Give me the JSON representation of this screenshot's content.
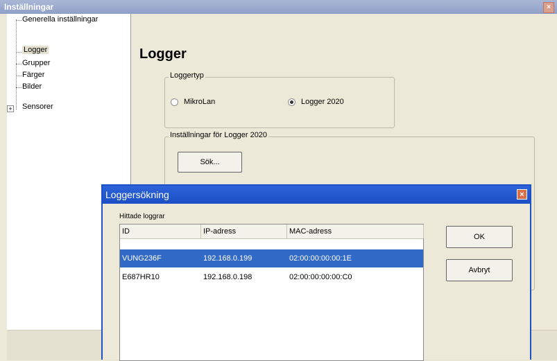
{
  "main_window": {
    "title": "Inställningar",
    "close_glyph": "×",
    "tree": {
      "items": [
        {
          "label": "Generella inställningar"
        },
        {
          "label": "Logger"
        },
        {
          "label": "Grupper"
        },
        {
          "label": "Färger"
        },
        {
          "label": "Bilder"
        },
        {
          "label": "Sensorer"
        }
      ],
      "expander_glyph": "+",
      "selected": "Logger"
    },
    "page_title": "Logger",
    "logger_type_group": {
      "legend": "Loggertyp",
      "options": [
        {
          "label": "MikroLan",
          "checked": false
        },
        {
          "label": "Logger 2020",
          "checked": true
        }
      ]
    },
    "settings_group": {
      "legend": "Inställningar för Logger 2020",
      "search_button": "Sök..."
    }
  },
  "dialog": {
    "title": "Loggersökning",
    "close_glyph": "×",
    "found_label": "Hittade loggrar",
    "columns": [
      "ID",
      "IP-adress",
      "MAC-adress"
    ],
    "rows": [
      {
        "id": "VUNG236F",
        "ip": "192.168.0.199",
        "mac": "02:00:00:00:00:1E",
        "selected": true
      },
      {
        "id": "E687HR10",
        "ip": "192.168.0.198",
        "mac": "02:00:00:00:00:C0",
        "selected": false
      }
    ],
    "ok_button": "OK",
    "cancel_button": "Avbryt"
  },
  "colors": {
    "dialog_title_bar": "#2d63d8",
    "selection": "#3169c6",
    "window_bg": "#ece9d8"
  }
}
